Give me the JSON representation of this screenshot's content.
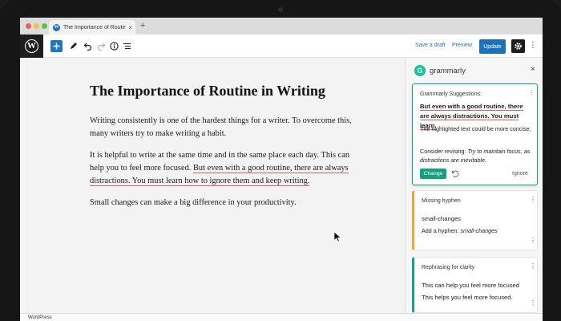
{
  "browser": {
    "tab_title": "The Importance of Routine in W",
    "tab_close": "×",
    "new_tab": "+",
    "favicon_letter": "W"
  },
  "toolbar": {
    "logo_letter": "W",
    "save_draft_label": "Save a draft",
    "preview_label": "Preview",
    "update_label": "Update"
  },
  "post": {
    "title": "The Importance of Routine in Writing",
    "paragraph_1": "Writing consistently is one of the hardest things for a writer. To overcome this, many writers try to make writing a habit.",
    "paragraph_2_before": "It is helpful to write at the same time and in the same place each day. This can help you to feel more focused. ",
    "paragraph_2_flagged": "But even with a good routine, there are always distractions. You must learn how to ignore them and keep writing.",
    "paragraph_3": "Small changes can make a big difference in your productivity."
  },
  "status_bar": {
    "label": "WordPress"
  },
  "grammarly": {
    "brand": "grammarly",
    "logo_letter": "G",
    "close": "×",
    "main_card": {
      "label": "Grammarly Suggestions:",
      "sentence": "But even with a good routine, there are always distractions. You must learn.",
      "reason": "The highlighted text could be more concise.",
      "revise_prefix": "Consider revising: ",
      "revise_suggestion": "Try to maintain focus, as distractions are inevitable.",
      "change_label": "Change",
      "ignore_label": "Ignore"
    },
    "hyphen_card": {
      "label": "Missing hyphen",
      "word": "small-changes",
      "add_prefix": "Add a hyphen: ",
      "add_value": "small-changes"
    },
    "rephrase_card": {
      "label": "Rephrasing for clarity",
      "option_1": "This can help you feel more focused",
      "option_2": "This helps you feel more focused."
    },
    "more_glyph": "⋮"
  },
  "colors": {
    "wp_blue": "#1a73b8",
    "grammarly_green": "#15a080",
    "error_red": "#e25b5b",
    "warning_orange": "#f0a640"
  }
}
